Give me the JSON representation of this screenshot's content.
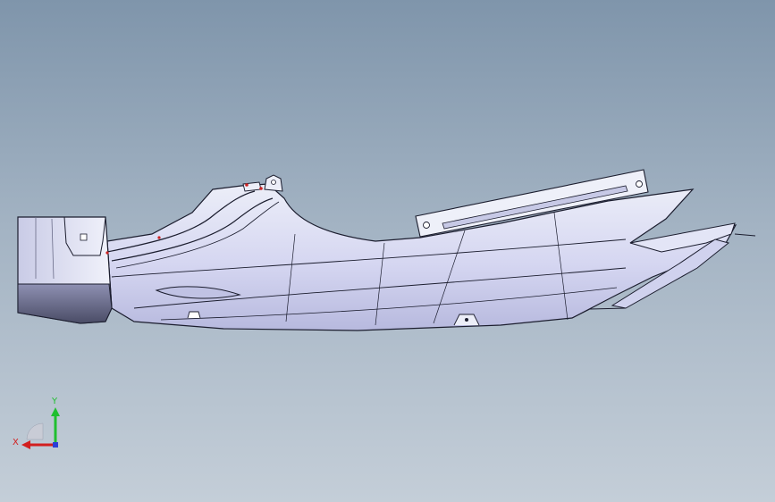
{
  "viewport": {
    "background_top": "#7f95ab",
    "background_bottom": "#c4ced8",
    "part_fill": "#d7d9f3",
    "part_shadow": "#a9abd2",
    "edge_color": "#1b1d2e",
    "highlight_color": "#cc2222"
  },
  "triad": {
    "x_label": "X",
    "y_label": "Y",
    "x_color": "#d21f1f",
    "y_color": "#1fbf2f",
    "z_color": "#2b3fd6"
  }
}
